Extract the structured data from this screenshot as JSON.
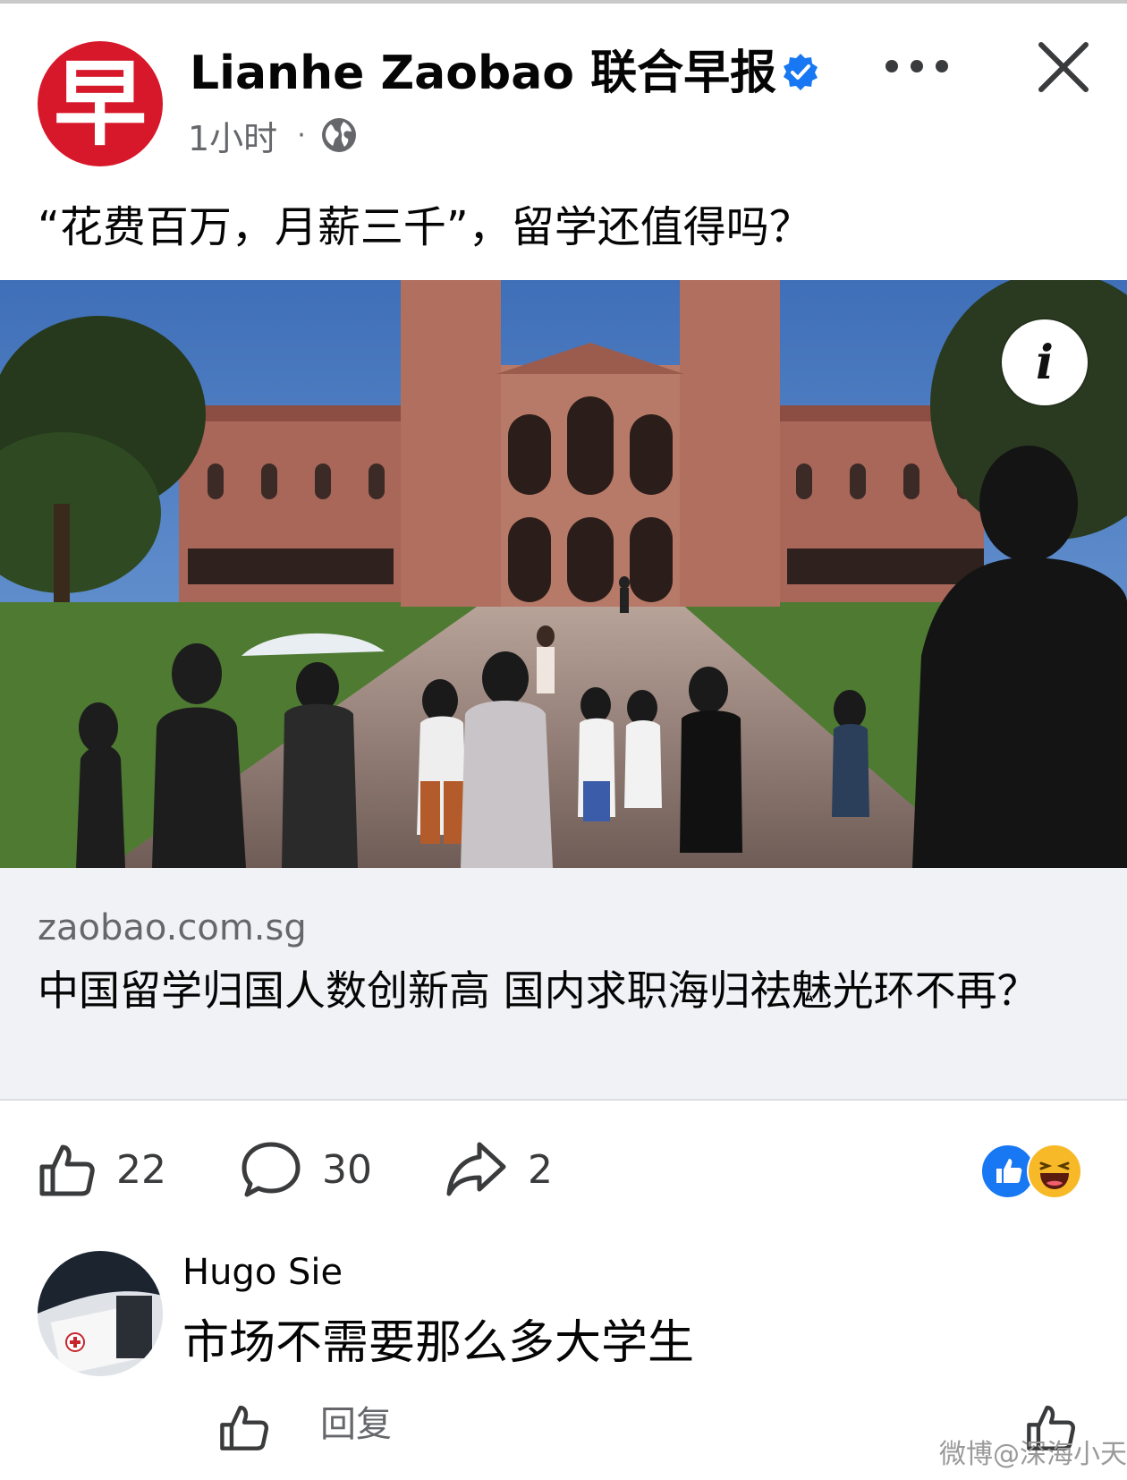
{
  "page": {
    "name": "Lianhe Zaobao 联合早报",
    "logo_char": "早",
    "time": "1小时",
    "separator": "·",
    "verified_icon": "verified-badge-icon",
    "privacy_icon": "globe-icon"
  },
  "post": {
    "text": "“花费百万，月薪三千”，留学还值得吗？",
    "image_alt": "campus-photo"
  },
  "link_preview": {
    "domain": "zaobao.com.sg",
    "title": "中国留学归国人数创新高 国内求职海归祛魅光环不再？"
  },
  "actions": {
    "likes": "22",
    "comments": "30",
    "shares": "2"
  },
  "comment": {
    "author": "Hugo Sie",
    "text": "市场不需要那么多大学生",
    "reply_label": "回复"
  },
  "watermark": "微博@深海小天",
  "colors": {
    "brand_red": "#d7182a",
    "facebook_blue": "#1877f2",
    "text_secondary": "#65676b",
    "link_bg": "#f0f2f5"
  }
}
